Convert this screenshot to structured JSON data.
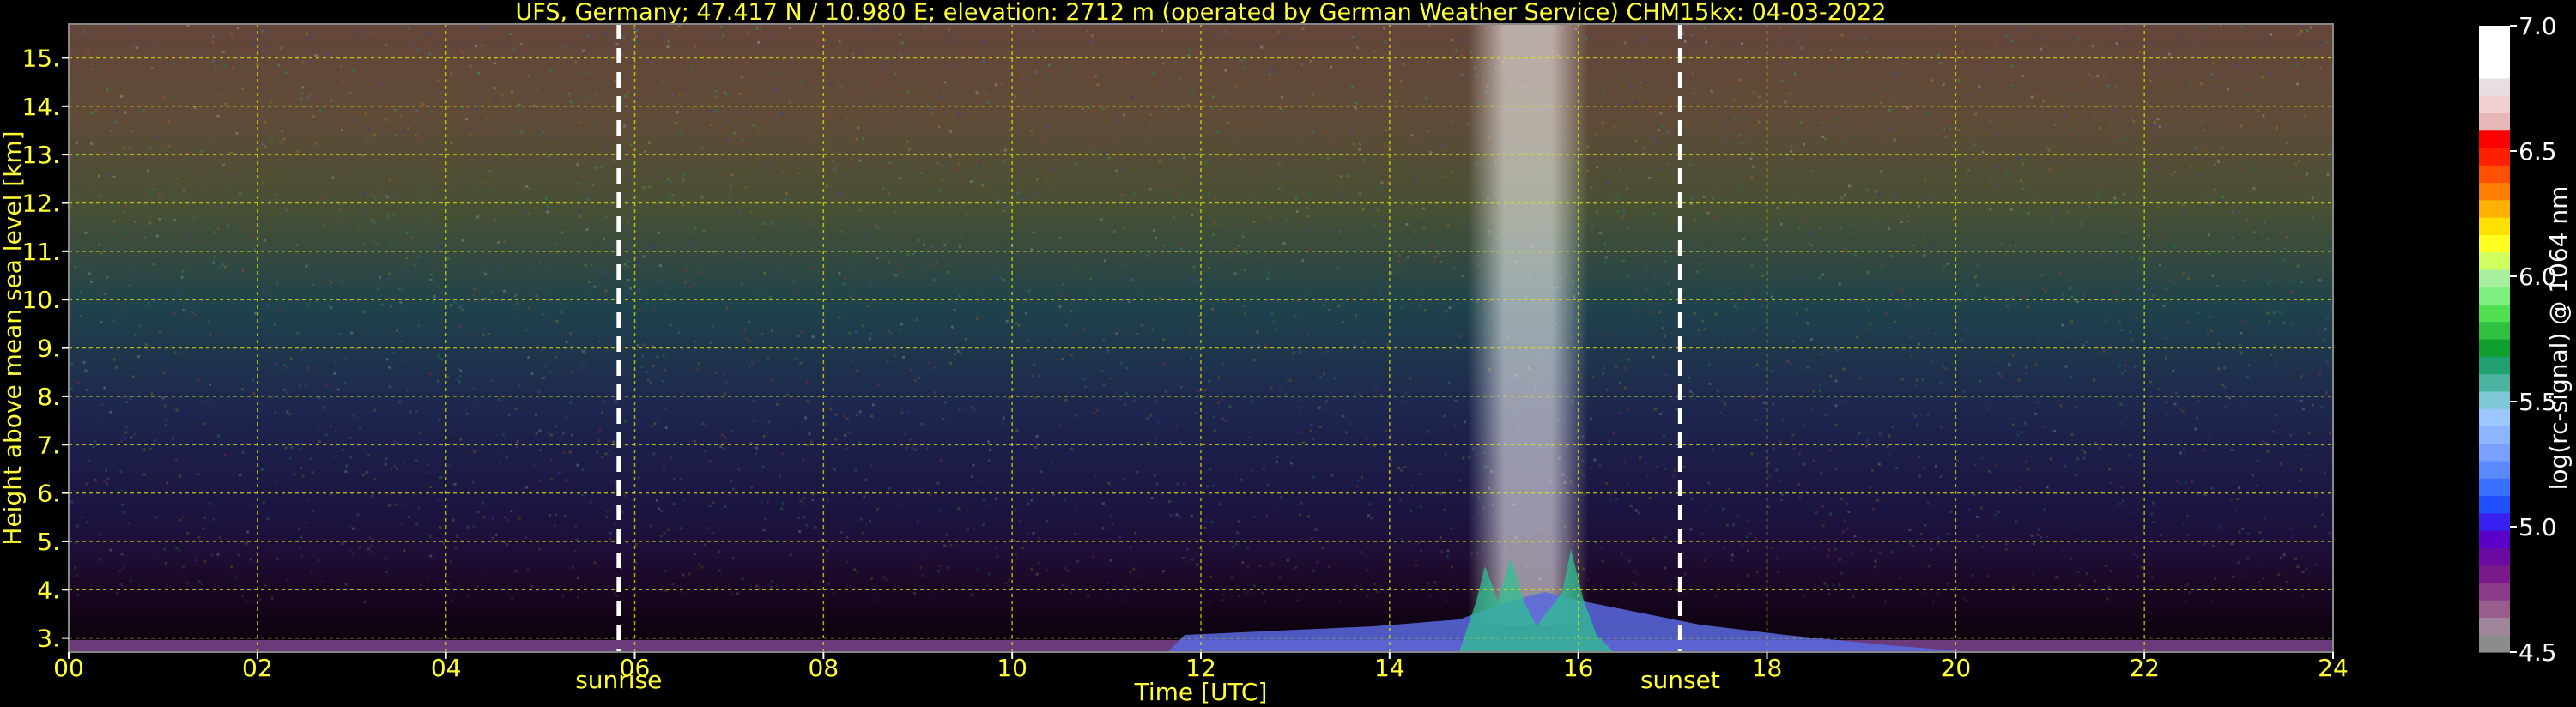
{
  "chart_data": {
    "type": "heatmap",
    "title": "UFS, Germany; 47.417 N / 10.980 E; elevation: 2712 m  (operated by German Weather Service)    CHM15kx: 04-03-2022",
    "xlabel": "Time [UTC]",
    "ylabel": "Height above mean sea level [km]",
    "xlim": [
      0,
      24
    ],
    "ylim": [
      2.71,
      15.7
    ],
    "x_ticks": [
      {
        "value": 0,
        "label": "00"
      },
      {
        "value": 2,
        "label": "02"
      },
      {
        "value": 4,
        "label": "04"
      },
      {
        "value": 6,
        "label": "06"
      },
      {
        "value": 8,
        "label": "08"
      },
      {
        "value": 10,
        "label": "10"
      },
      {
        "value": 12,
        "label": "12"
      },
      {
        "value": 14,
        "label": "14"
      },
      {
        "value": 16,
        "label": "16"
      },
      {
        "value": 18,
        "label": "18"
      },
      {
        "value": 20,
        "label": "20"
      },
      {
        "value": 22,
        "label": "22"
      },
      {
        "value": 24,
        "label": "24"
      }
    ],
    "y_ticks": [
      {
        "value": 3,
        "label": "3."
      },
      {
        "value": 4,
        "label": "4."
      },
      {
        "value": 5,
        "label": "5."
      },
      {
        "value": 6,
        "label": "6."
      },
      {
        "value": 7,
        "label": "7."
      },
      {
        "value": 8,
        "label": "8."
      },
      {
        "value": 9,
        "label": "9."
      },
      {
        "value": 10,
        "label": "10."
      },
      {
        "value": 11,
        "label": "11."
      },
      {
        "value": 12,
        "label": "12."
      },
      {
        "value": 13,
        "label": "13."
      },
      {
        "value": 14,
        "label": "14."
      },
      {
        "value": 15,
        "label": "15."
      }
    ],
    "grid": true,
    "events": [
      {
        "label": "sunrise",
        "time": 5.83
      },
      {
        "label": "sunset",
        "time": 17.08
      }
    ],
    "colorbar": {
      "label": "log(rc-signal) @ 1064 nm",
      "range": [
        4.5,
        7.0
      ],
      "ticks": [
        {
          "value": 4.5,
          "label": "4.5"
        },
        {
          "value": 5.0,
          "label": "5.0"
        },
        {
          "value": 5.5,
          "label": "5.5"
        },
        {
          "value": 6.0,
          "label": "6.0"
        },
        {
          "value": 6.5,
          "label": "6.5"
        },
        {
          "value": 7.0,
          "label": "7.0"
        }
      ],
      "colors": [
        "#8c8c8c",
        "#a0869c",
        "#9a5c8c",
        "#8a3a8a",
        "#7a1a8a",
        "#6a0aa0",
        "#5a00c8",
        "#3a20f0",
        "#2050ff",
        "#3a70ff",
        "#5a88ff",
        "#7aa0ff",
        "#8cb4ff",
        "#9cc8ff",
        "#7ec8d8",
        "#4ab4a0",
        "#20a070",
        "#10a030",
        "#30c040",
        "#50e050",
        "#80f080",
        "#a8f0a0",
        "#d0ff60",
        "#ffff20",
        "#ffe000",
        "#ffb000",
        "#ff8000",
        "#ff5000",
        "#ff2000",
        "#ff0000",
        "#e8b8b8",
        "#f0d0d0",
        "#e8e0e0",
        "#ffffff",
        "#ffffff",
        "#ffffff"
      ]
    }
  }
}
